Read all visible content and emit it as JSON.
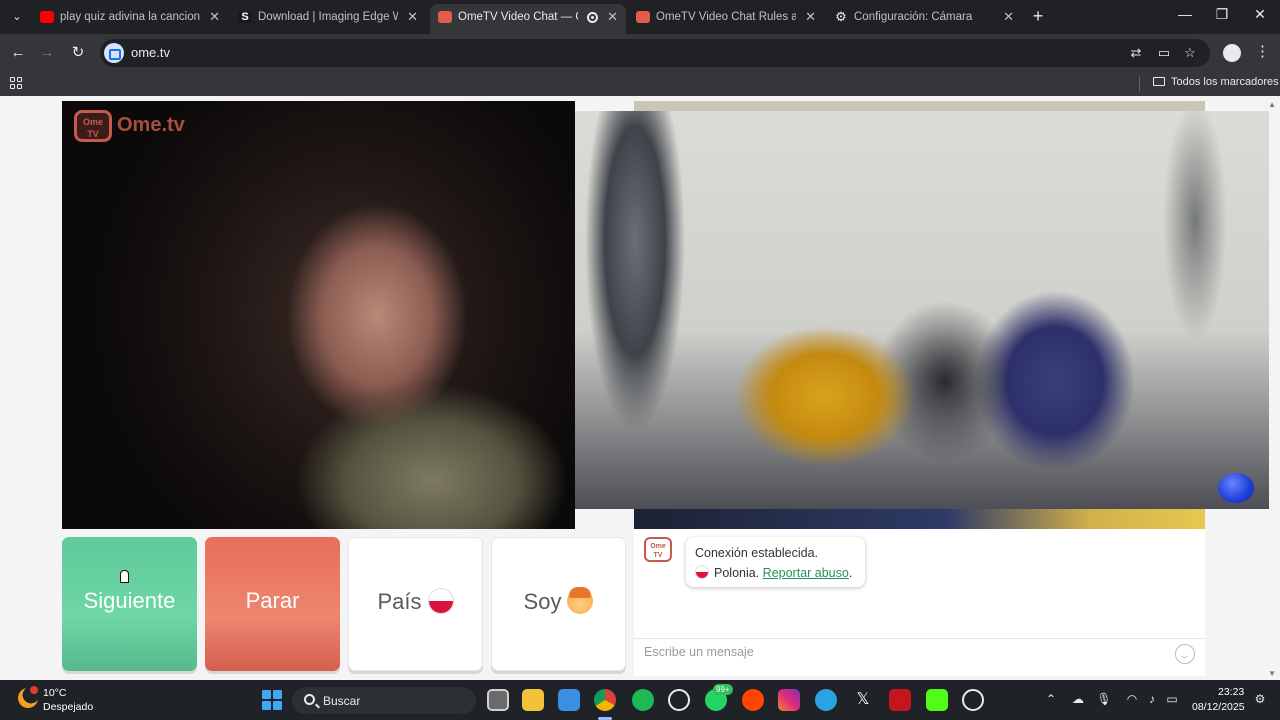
{
  "browser": {
    "tabs": [
      {
        "title": "play quiz adivina la cancion - Y",
        "favicon": "youtube-icon",
        "color": "#ff0000"
      },
      {
        "title": "Download | Imaging Edge Web",
        "favicon": "s-icon",
        "color": "#ffffff"
      },
      {
        "title": "OmeTV Video Chat — Ome",
        "favicon": "ometv-icon",
        "color": "#e35b4b",
        "active": true
      },
      {
        "title": "OmeTV Video Chat Rules and R",
        "favicon": "ometv-icon",
        "color": "#e35b4b"
      },
      {
        "title": "Configuración: Cámara",
        "favicon": "gear-icon",
        "color": "#e8eaed"
      }
    ],
    "url": "ome.tv",
    "bookmarks_all": "Todos los marcadores"
  },
  "ometv": {
    "logo_text": "Ome.tv",
    "logo_badge": "Ome TV",
    "buttons": {
      "next": "Siguiente",
      "stop": "Parar",
      "country": "País",
      "gender": "Soy"
    },
    "chat": {
      "connection": "Conexión establecida.",
      "country": "Polonia.",
      "report": "Reportar abuso",
      "report_suffix": ".",
      "placeholder": "Escribe un mensaje"
    }
  },
  "taskbar": {
    "weather_temp": "10°C",
    "weather_desc": "Despejado",
    "search_label": "Buscar",
    "whatsapp_badge": "99+",
    "time": "23:23",
    "date": "08/12/2025",
    "apps": [
      "task-view-icon",
      "file-explorer-icon",
      "store-icon",
      "chrome-icon",
      "spotify-icon",
      "chatgpt-icon",
      "whatsapp-icon",
      "reddit-icon",
      "instagram-icon",
      "telegram-icon",
      "x-icon",
      "acrobat-icon",
      "kick-icon",
      "steam-icon"
    ]
  }
}
